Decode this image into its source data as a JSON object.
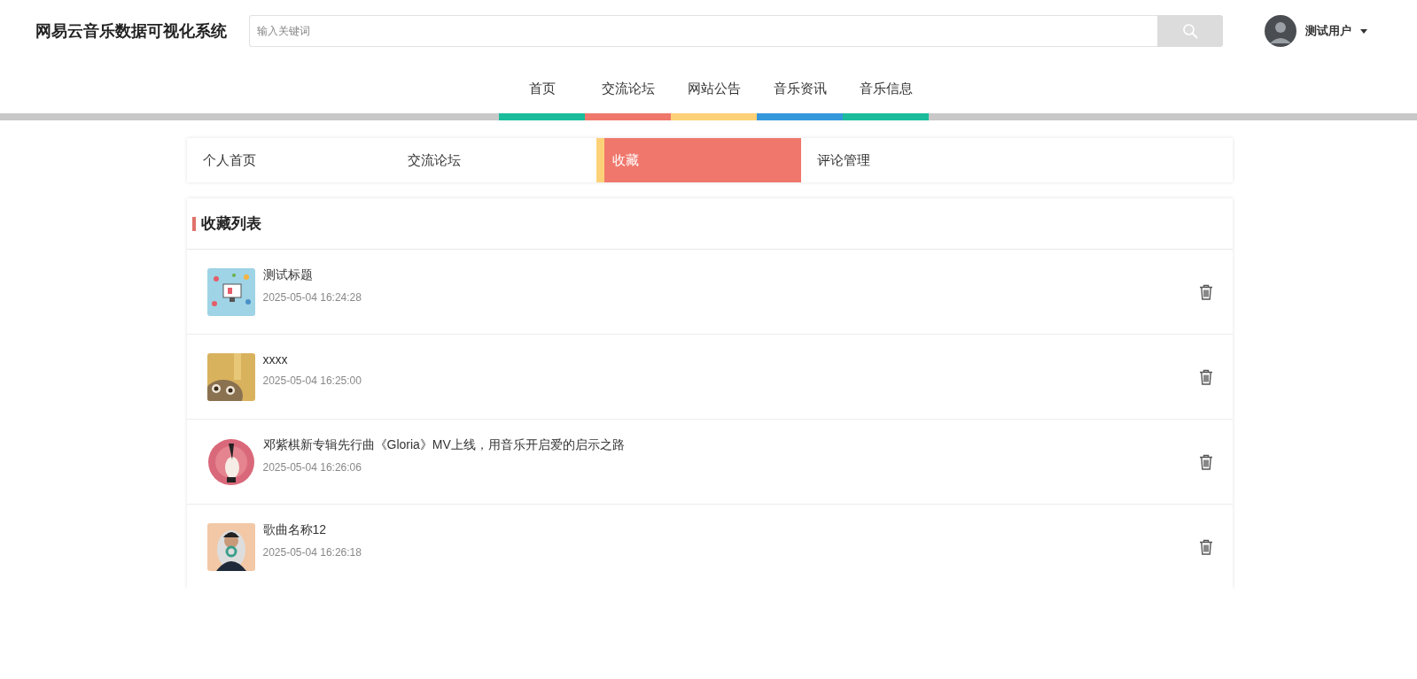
{
  "header": {
    "site_title": "网易云音乐数据可视化系统",
    "search": {
      "placeholder": "输入关键词"
    },
    "user": {
      "name": "测试用户"
    }
  },
  "nav": [
    {
      "label": "首页",
      "color": "#1abc9c"
    },
    {
      "label": "交流论坛",
      "color": "#f0776c"
    },
    {
      "label": "网站公告",
      "color": "#fdd177"
    },
    {
      "label": "音乐资讯",
      "color": "#3498db"
    },
    {
      "label": "音乐信息",
      "color": "#1abc9c"
    }
  ],
  "tabs": [
    {
      "label": "个人首页",
      "selected": false
    },
    {
      "label": "交流论坛",
      "selected": false
    },
    {
      "label": "收藏",
      "selected": true
    },
    {
      "label": "评论管理",
      "selected": false
    }
  ],
  "favorites": {
    "title": "收藏列表",
    "items": [
      {
        "title": "测试标题",
        "time": "2025-05-04 16:24:28"
      },
      {
        "title": "xxxx",
        "time": "2025-05-04 16:25:00"
      },
      {
        "title": "邓紫棋新专辑先行曲《Gloria》MV上线，用音乐开启爱的启示之路",
        "time": "2025-05-04 16:26:06"
      },
      {
        "title": "歌曲名称12",
        "time": "2025-05-04 16:26:18"
      }
    ]
  }
}
